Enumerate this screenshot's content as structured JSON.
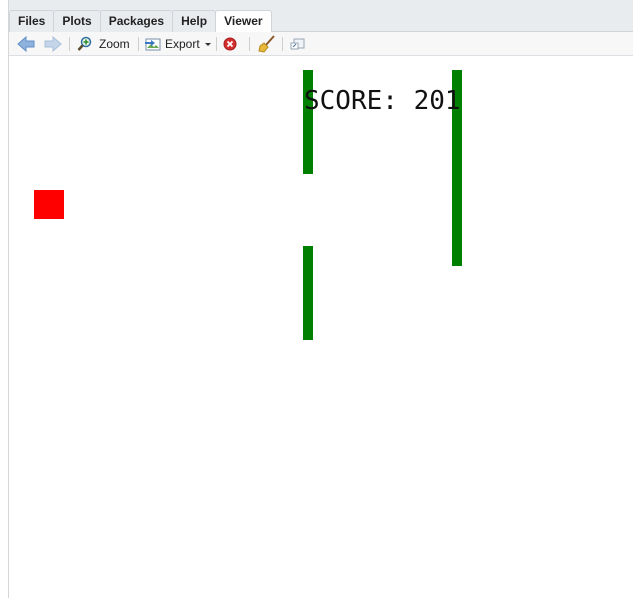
{
  "tabs": [
    {
      "label": "Files",
      "active": false
    },
    {
      "label": "Plots",
      "active": false
    },
    {
      "label": "Packages",
      "active": false
    },
    {
      "label": "Help",
      "active": false
    },
    {
      "label": "Viewer",
      "active": true
    }
  ],
  "toolbar": {
    "zoom_label": "Zoom",
    "export_label": "Export",
    "icons": [
      "back-arrow-icon",
      "forward-arrow-icon",
      "zoom-icon",
      "export-icon",
      "dropdown-caret-icon",
      "remove-icon",
      "broom-icon",
      "popout-icon"
    ]
  },
  "game": {
    "score_text": "SCORE: 201",
    "colors": {
      "pipe": "#008000",
      "bird": "#ff0000",
      "background": "#ffffff"
    }
  }
}
